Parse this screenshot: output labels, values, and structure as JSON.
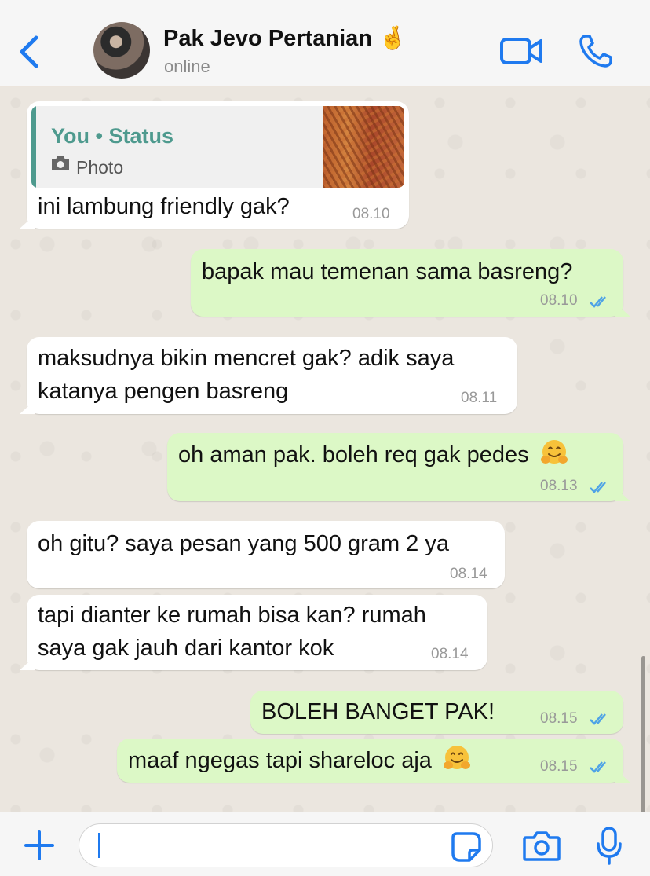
{
  "header": {
    "contact_name": "Pak Jevo Pertanian",
    "contact_emoji": "🤞",
    "status": "online",
    "accent_color": "#1f7aef",
    "icons": [
      "back-icon",
      "avatar",
      "video-call-icon",
      "phone-call-icon"
    ]
  },
  "messages": [
    {
      "direction": "incoming",
      "quote": {
        "title": "You • Status",
        "type": "Photo"
      },
      "text": "ini lambung friendly gak?",
      "time": "08.10"
    },
    {
      "direction": "outgoing",
      "text": "bapak mau temenan sama basreng?",
      "time": "08.10",
      "read": true
    },
    {
      "direction": "incoming",
      "lines": [
        "maksudnya bikin mencret gak? adik saya",
        "katanya pengen basreng"
      ],
      "time": "08.11"
    },
    {
      "direction": "outgoing",
      "text": "oh aman pak. boleh req gak pedes",
      "emoji": "hugging-face",
      "time": "08.13",
      "read": true
    },
    {
      "direction": "incoming",
      "text": "oh gitu? saya pesan yang 500 gram 2 ya",
      "time": "08.14"
    },
    {
      "direction": "incoming",
      "lines": [
        "tapi dianter ke rumah bisa kan? rumah",
        "saya gak jauh dari kantor kok"
      ],
      "time": "08.14"
    },
    {
      "direction": "outgoing",
      "text": "BOLEH BANGET PAK!",
      "time": "08.15",
      "read": true
    },
    {
      "direction": "outgoing",
      "text": "maaf ngegas tapi shareloc aja",
      "emoji": "hugging-face",
      "time": "08.15",
      "read": true
    }
  ],
  "composer": {
    "value": "",
    "icons": [
      "plus-icon",
      "sticker-icon",
      "camera-icon",
      "microphone-icon"
    ]
  },
  "colors": {
    "outgoing_bubble": "#dcf8c6",
    "incoming_bubble": "#ffffff",
    "read_ticks": "#4fa3e6",
    "quote_accent": "#4e9a8e"
  }
}
